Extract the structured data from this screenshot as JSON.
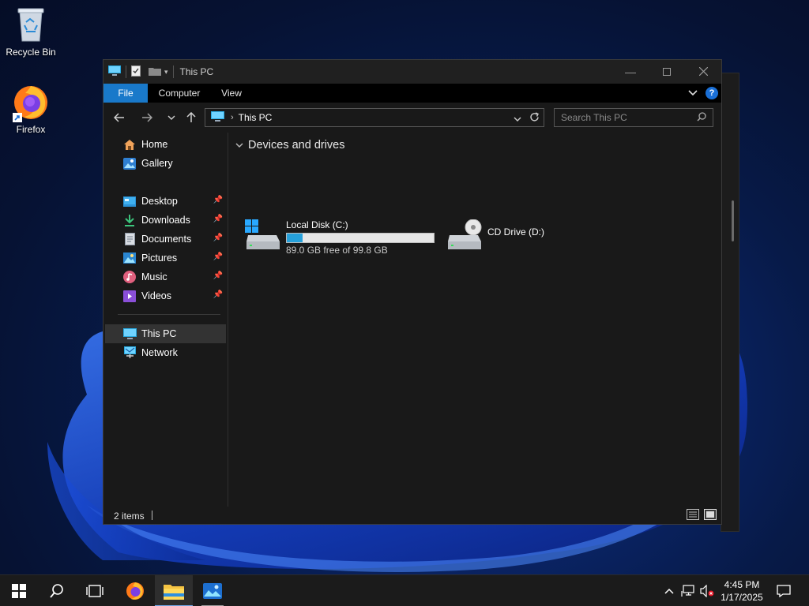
{
  "desktop": {
    "icons": [
      {
        "label": "Recycle Bin",
        "icon": "recycle-bin-icon"
      },
      {
        "label": "Firefox",
        "icon": "firefox-icon"
      }
    ]
  },
  "window": {
    "title": "This PC",
    "ribbon_tabs": [
      "File",
      "Computer",
      "View"
    ],
    "address": {
      "crumb": "This PC"
    },
    "search": {
      "placeholder": "Search This PC"
    }
  },
  "sidebar": {
    "quick": [
      {
        "label": "Home",
        "icon": "home-icon"
      },
      {
        "label": "Gallery",
        "icon": "gallery-icon"
      }
    ],
    "pinned": [
      {
        "label": "Desktop",
        "icon": "desktop-folder-icon"
      },
      {
        "label": "Downloads",
        "icon": "downloads-icon"
      },
      {
        "label": "Documents",
        "icon": "documents-icon"
      },
      {
        "label": "Pictures",
        "icon": "pictures-icon"
      },
      {
        "label": "Music",
        "icon": "music-icon"
      },
      {
        "label": "Videos",
        "icon": "videos-icon"
      }
    ],
    "locations": [
      {
        "label": "This PC",
        "icon": "this-pc-icon",
        "selected": true
      },
      {
        "label": "Network",
        "icon": "network-icon"
      }
    ]
  },
  "content": {
    "group_title": "Devices and drives",
    "drives": [
      {
        "name": "Local Disk (C:)",
        "free_text": "89.0 GB free of 99.8 GB",
        "used_fraction": 0.108,
        "icon": "local-disk-icon"
      },
      {
        "name": "CD Drive (D:)",
        "icon": "cd-drive-icon"
      }
    ]
  },
  "status": {
    "items": "2 items"
  },
  "taskbar": {
    "apps": [
      "start-icon",
      "search-icon",
      "task-view-icon",
      "firefox-icon",
      "file-explorer-icon",
      "photos-icon"
    ],
    "time": "4:45 PM",
    "date": "1/17/2025"
  },
  "colors": {
    "accent": "#1979ca",
    "bar_fill": "#26a0da",
    "taskbar": "#1b1b1b"
  }
}
